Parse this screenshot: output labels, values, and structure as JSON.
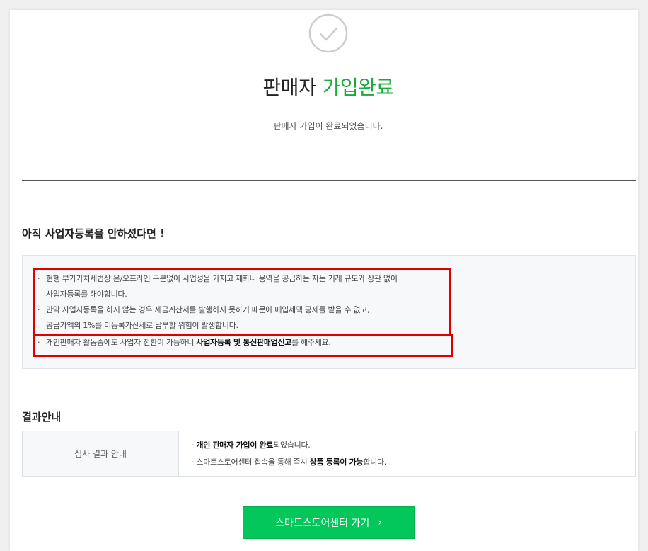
{
  "header": {
    "title_main": "판매자",
    "title_accent": "가입완료",
    "subtitle": "판매자 가입이 완료되었습니다.",
    "accent_color": "#1aaa3a"
  },
  "notice": {
    "heading": "아직 사업자등록을 안하셨다면 !",
    "items": [
      {
        "line1": "현행 부가가치세법상 온/오프라인 구분없이 사업성을 가지고 재화나 용역을 공급하는 자는 거래 규모와 상관 없이",
        "line2": "사업자등록를 해야합니다."
      },
      {
        "line1": "만약 사업자등록을 하지 않는 경우 세금계산서를 발행하지 못하기 때문에 매입세액 공제를 받을 수 없고,",
        "line2": "공급가액의 1%를 미등록가산세로 납부할 위험이 발생합니다."
      }
    ],
    "last_item": {
      "pre": "개인판매자 활동중에도 사업자 전환이 가능하니 ",
      "bold": "사업자등록 및 통신판매업신고",
      "post": "를 해주세요."
    },
    "highlight_color": "#e00000"
  },
  "result": {
    "heading": "결과안내",
    "row_label": "심사 결과 안내",
    "line1": {
      "bold": "개인 판매자 가입이 완료",
      "post": "되었습니다."
    },
    "line2": {
      "pre": "스마트스토어센터 접속을 통해 즉시 ",
      "bold": "상품 등록이 가능",
      "post": "합니다."
    }
  },
  "cta": {
    "label": "스마트스토어센터 가기",
    "icon": "chevron-right-icon",
    "color": "#03c75a"
  }
}
